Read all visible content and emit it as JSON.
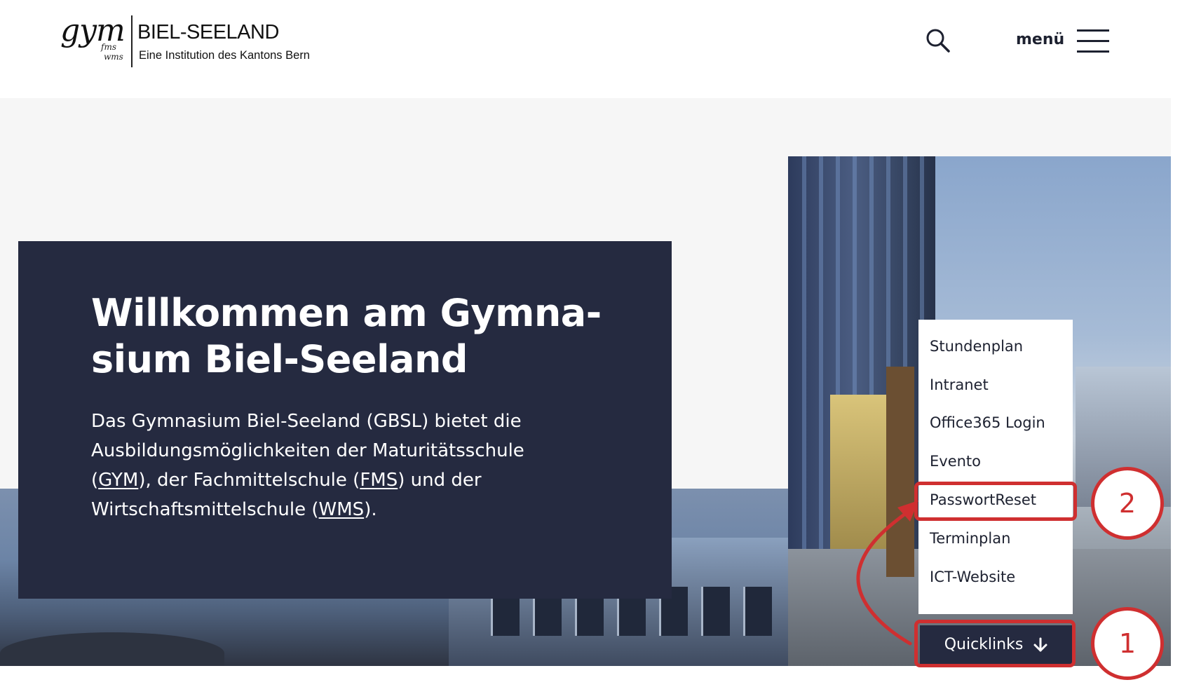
{
  "header": {
    "logo": {
      "gym": "gym",
      "fms": "fms",
      "wms": "wms",
      "title": "BIEL-SEELAND",
      "subtitle": "Eine Institution des Kantons Bern"
    },
    "search_icon": "search-icon",
    "menu_label": "menü",
    "menu_icon": "hamburger-icon"
  },
  "welcome": {
    "title_line1": "Willkommen am Gymna-",
    "title_line2": "sium Biel-Seeland",
    "intro_part1": "Das Gymnasium Biel-Seeland (GBSL) bietet die Ausbildungsmöglichkeiten der Maturitätsschule (",
    "link_gym": "GYM",
    "intro_part2": "), der Fachmittelschule (",
    "link_fms": "FMS",
    "intro_part3": ") und der Wirtschaftsmittelschule (",
    "link_wms": "WMS",
    "intro_part4": ")."
  },
  "quicklinks": {
    "items": [
      {
        "label": "Stundenplan"
      },
      {
        "label": "Intranet"
      },
      {
        "label": "Office365 Login"
      },
      {
        "label": "Evento"
      },
      {
        "label": "PasswortReset"
      },
      {
        "label": "Terminplan"
      },
      {
        "label": "ICT-Website"
      }
    ],
    "button_label": "Quicklinks",
    "button_icon": "arrow-down-icon"
  },
  "annotations": {
    "step1": "1",
    "step2": "2",
    "color": "#cf2f30"
  },
  "colors": {
    "navy": "#252a40",
    "hero_bg": "#f6f6f6"
  }
}
